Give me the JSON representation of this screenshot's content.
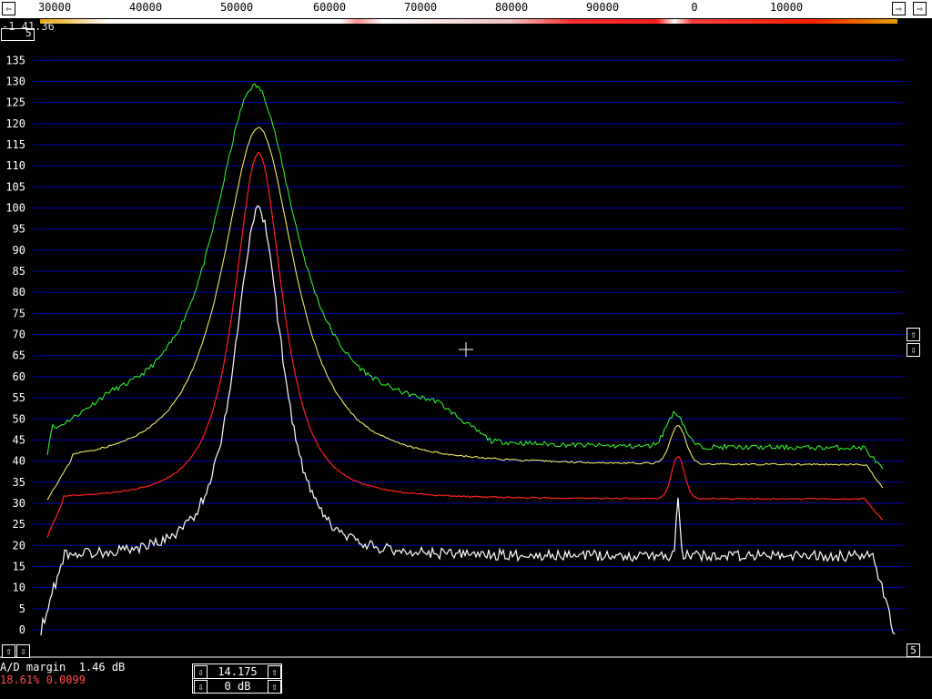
{
  "frequency_scale": {
    "ticks": [
      "30000",
      "40000",
      "50000",
      "60000",
      "70000",
      "80000",
      "90000",
      "0",
      "10000"
    ]
  },
  "corner": {
    "value_text": "-1 41.36",
    "box_digit": "5"
  },
  "y_axis": {
    "ticks": [
      "135",
      "130",
      "125",
      "120",
      "115",
      "110",
      "105",
      "100",
      "95",
      "90",
      "85",
      "80",
      "75",
      "70",
      "65",
      "60",
      "55",
      "50",
      "45",
      "40",
      "35",
      "30",
      "25",
      "20",
      "15",
      "10",
      "5",
      "0"
    ]
  },
  "buttons": {
    "scroll_left": "⇦",
    "scroll_right": "⇨",
    "up": "⇧",
    "down": "⇩",
    "right_number": "5"
  },
  "status": {
    "ad_margin": "A/D margin  1.46 dB",
    "level_readout": "18.61% 0.0099"
  },
  "control_box": {
    "frequency": "14.175",
    "gain": "0 dB"
  },
  "colors": {
    "background": "#000000",
    "grid": "#0000aa",
    "trace_green": "#33ff33",
    "trace_yellow": "#ffff66",
    "trace_red": "#ff2020",
    "trace_white": "#ffffff",
    "status_red": "#ff4a4a"
  }
}
